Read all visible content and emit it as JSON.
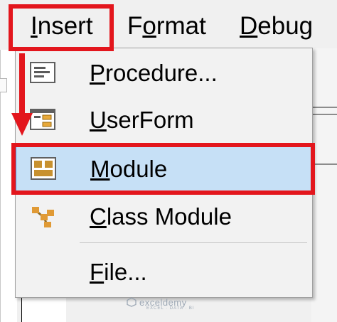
{
  "menubar": {
    "items": [
      {
        "label_rest": "nsert",
        "mnemonic": "I"
      },
      {
        "label_rest": "ormat",
        "mnemonic": "F",
        "prefix": "F",
        "suffix": "ormat"
      },
      {
        "label_rest": "ebug",
        "mnemonic": "D"
      }
    ]
  },
  "dropdown": {
    "items": [
      {
        "mnemonic": "P",
        "rest": "rocedure...",
        "icon": "procedure-icon"
      },
      {
        "mnemonic": "U",
        "rest": "serForm",
        "icon": "userform-icon"
      },
      {
        "mnemonic": "M",
        "rest": "odule",
        "icon": "module-icon",
        "selected": true
      },
      {
        "mnemonic": "C",
        "rest": "lass Module",
        "icon": "class-module-icon"
      },
      {
        "mnemonic": "F",
        "rest": "ile...",
        "icon": "file-icon"
      }
    ]
  },
  "colors": {
    "highlight_red": "#e3161d",
    "selected_bg": "#c6e0f6",
    "selected_border": "#4a90d6",
    "menu_bg": "#f2f2f2"
  },
  "watermark": {
    "name": "exceldemy",
    "tagline": "EXCEL · DATA · BI"
  }
}
